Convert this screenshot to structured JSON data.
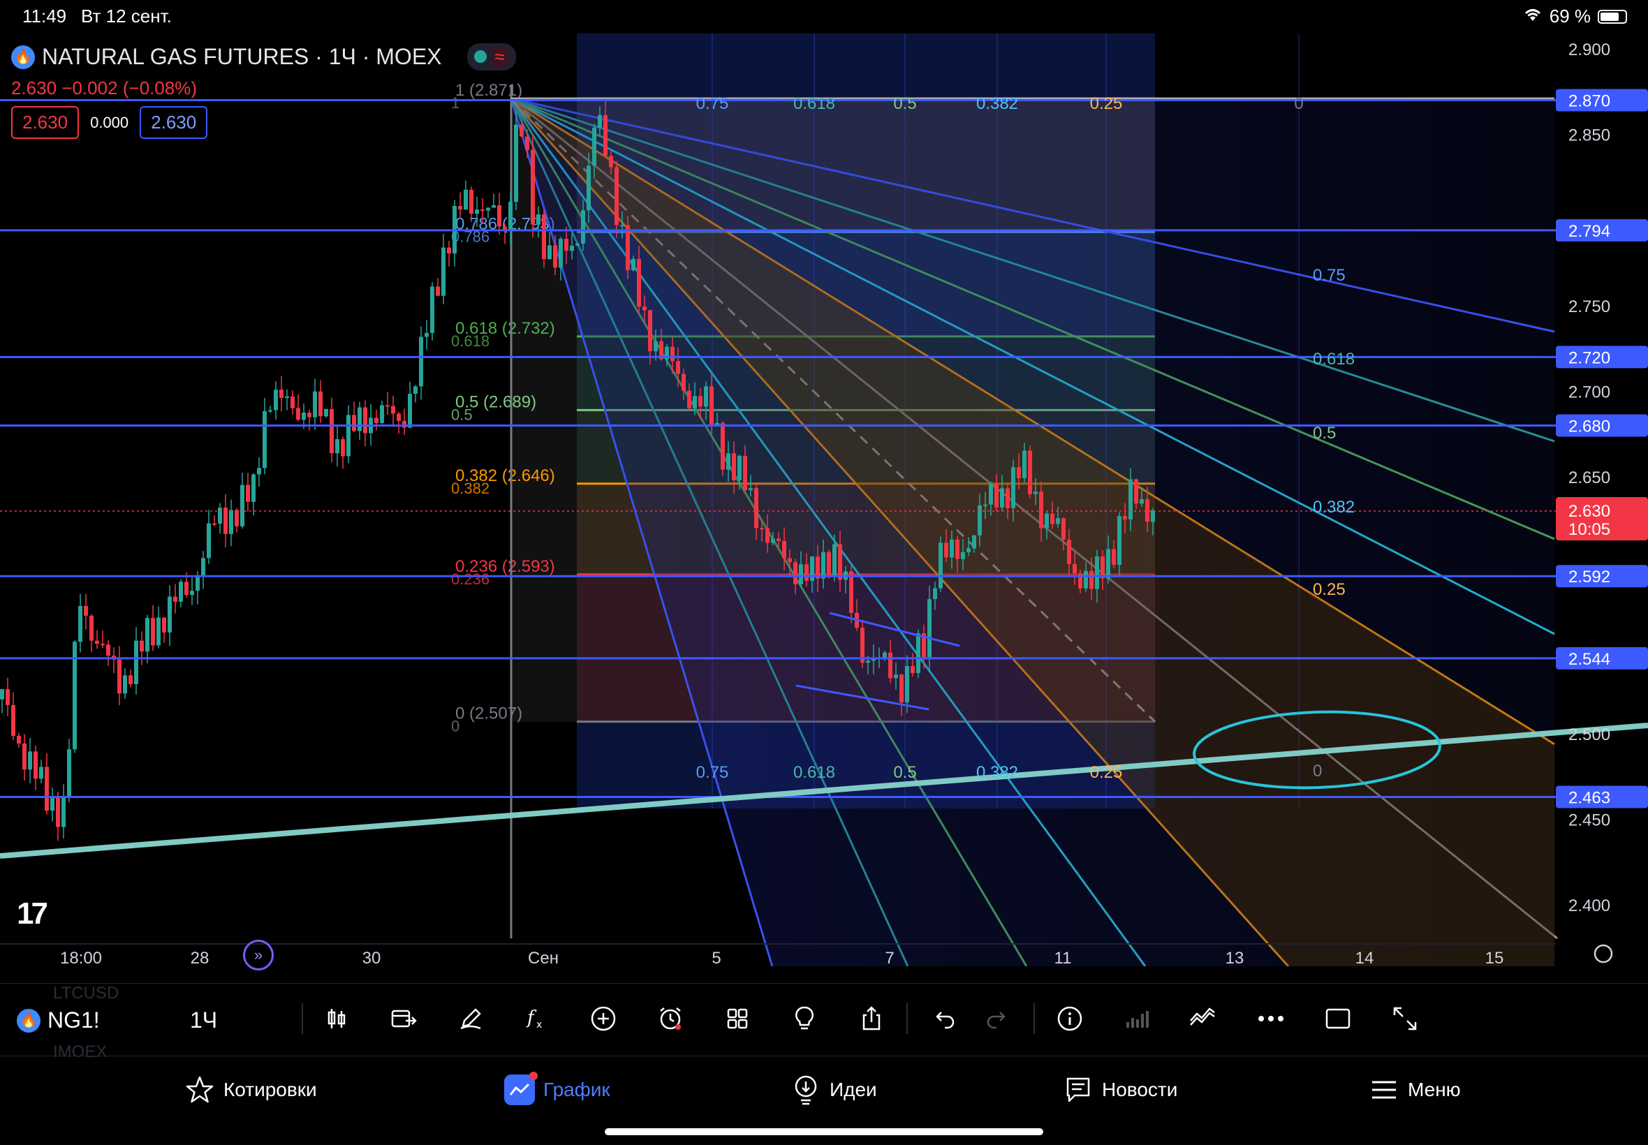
{
  "status_bar": {
    "time": "11:49",
    "date": "Вт 12 сент.",
    "battery": "69 %"
  },
  "header": {
    "symbol_title": "NATURAL GAS FUTURES · 1Ч · MOEX",
    "price_change": "2.630  −0.002 (−0.08%)",
    "bid": "2.630",
    "spread": "0.000",
    "ask": "2.630"
  },
  "price_axis": {
    "ticks": [
      {
        "label": "2.900",
        "value": 2.9
      },
      {
        "label": "2.850",
        "value": 2.85
      },
      {
        "label": "2.750",
        "value": 2.75
      },
      {
        "label": "2.700",
        "value": 2.7
      },
      {
        "label": "2.650",
        "value": 2.65
      },
      {
        "label": "2.500",
        "value": 2.5
      },
      {
        "label": "2.450",
        "value": 2.45
      },
      {
        "label": "2.400",
        "value": 2.4
      }
    ],
    "badges": [
      {
        "label": "2.870",
        "value": 2.87
      },
      {
        "label": "2.794",
        "value": 2.794
      },
      {
        "label": "2.720",
        "value": 2.72
      },
      {
        "label": "2.680",
        "value": 2.68
      },
      {
        "label": "2.592",
        "value": 2.592
      },
      {
        "label": "2.544",
        "value": 2.544
      },
      {
        "label": "2.463",
        "value": 2.463
      }
    ],
    "last_price": {
      "label": "2.630",
      "countdown": "10:05",
      "value": 2.63
    }
  },
  "time_axis": [
    "18:00",
    "28",
    "30",
    "Сен",
    "5",
    "7",
    "11",
    "13",
    "14",
    "15"
  ],
  "fib_levels": [
    {
      "ratio": "1",
      "label": "1 (2.871)",
      "value": 2.871,
      "color": "#787b86"
    },
    {
      "ratio": "0.786",
      "label": "0.786 (2.793)",
      "value": 2.793,
      "color": "#5b9cf6"
    },
    {
      "ratio": "0.618",
      "label": "0.618 (2.732)",
      "value": 2.732,
      "color": "#4caf50"
    },
    {
      "ratio": "0.5",
      "label": "0.5 (2.689)",
      "value": 2.689,
      "color": "#81c784"
    },
    {
      "ratio": "0.382",
      "label": "0.382 (2.646)",
      "value": 2.646,
      "color": "#ff9800"
    },
    {
      "ratio": "0.236",
      "label": "0.236 (2.593)",
      "value": 2.593,
      "color": "#f23645"
    },
    {
      "ratio": "0",
      "label": "0 (2.507)",
      "value": 2.507,
      "color": "#787b86"
    }
  ],
  "fan_labels_top": [
    "0.75",
    "0.618",
    "0.5",
    "0.382",
    "0.25",
    "0"
  ],
  "fan_labels_bottom": [
    "0.75",
    "0.618",
    "0.5",
    "0.382",
    "0.25"
  ],
  "fan_labels_right": [
    "0.75",
    "0.618",
    "0.5",
    "0.382",
    "0.25",
    "0"
  ],
  "toolbar": {
    "symbol": "NG1!",
    "interval": "1Ч",
    "ghost_top": "LTCUSD",
    "ghost_bottom": "IMOEX"
  },
  "nav": {
    "quotes": "Котировки",
    "chart": "График",
    "ideas": "Идеи",
    "news": "Новости",
    "menu": "Меню"
  },
  "colors": {
    "accent": "#2962ff",
    "up": "#26a69a",
    "down": "#f23645",
    "hline": "#3d5afe"
  }
}
